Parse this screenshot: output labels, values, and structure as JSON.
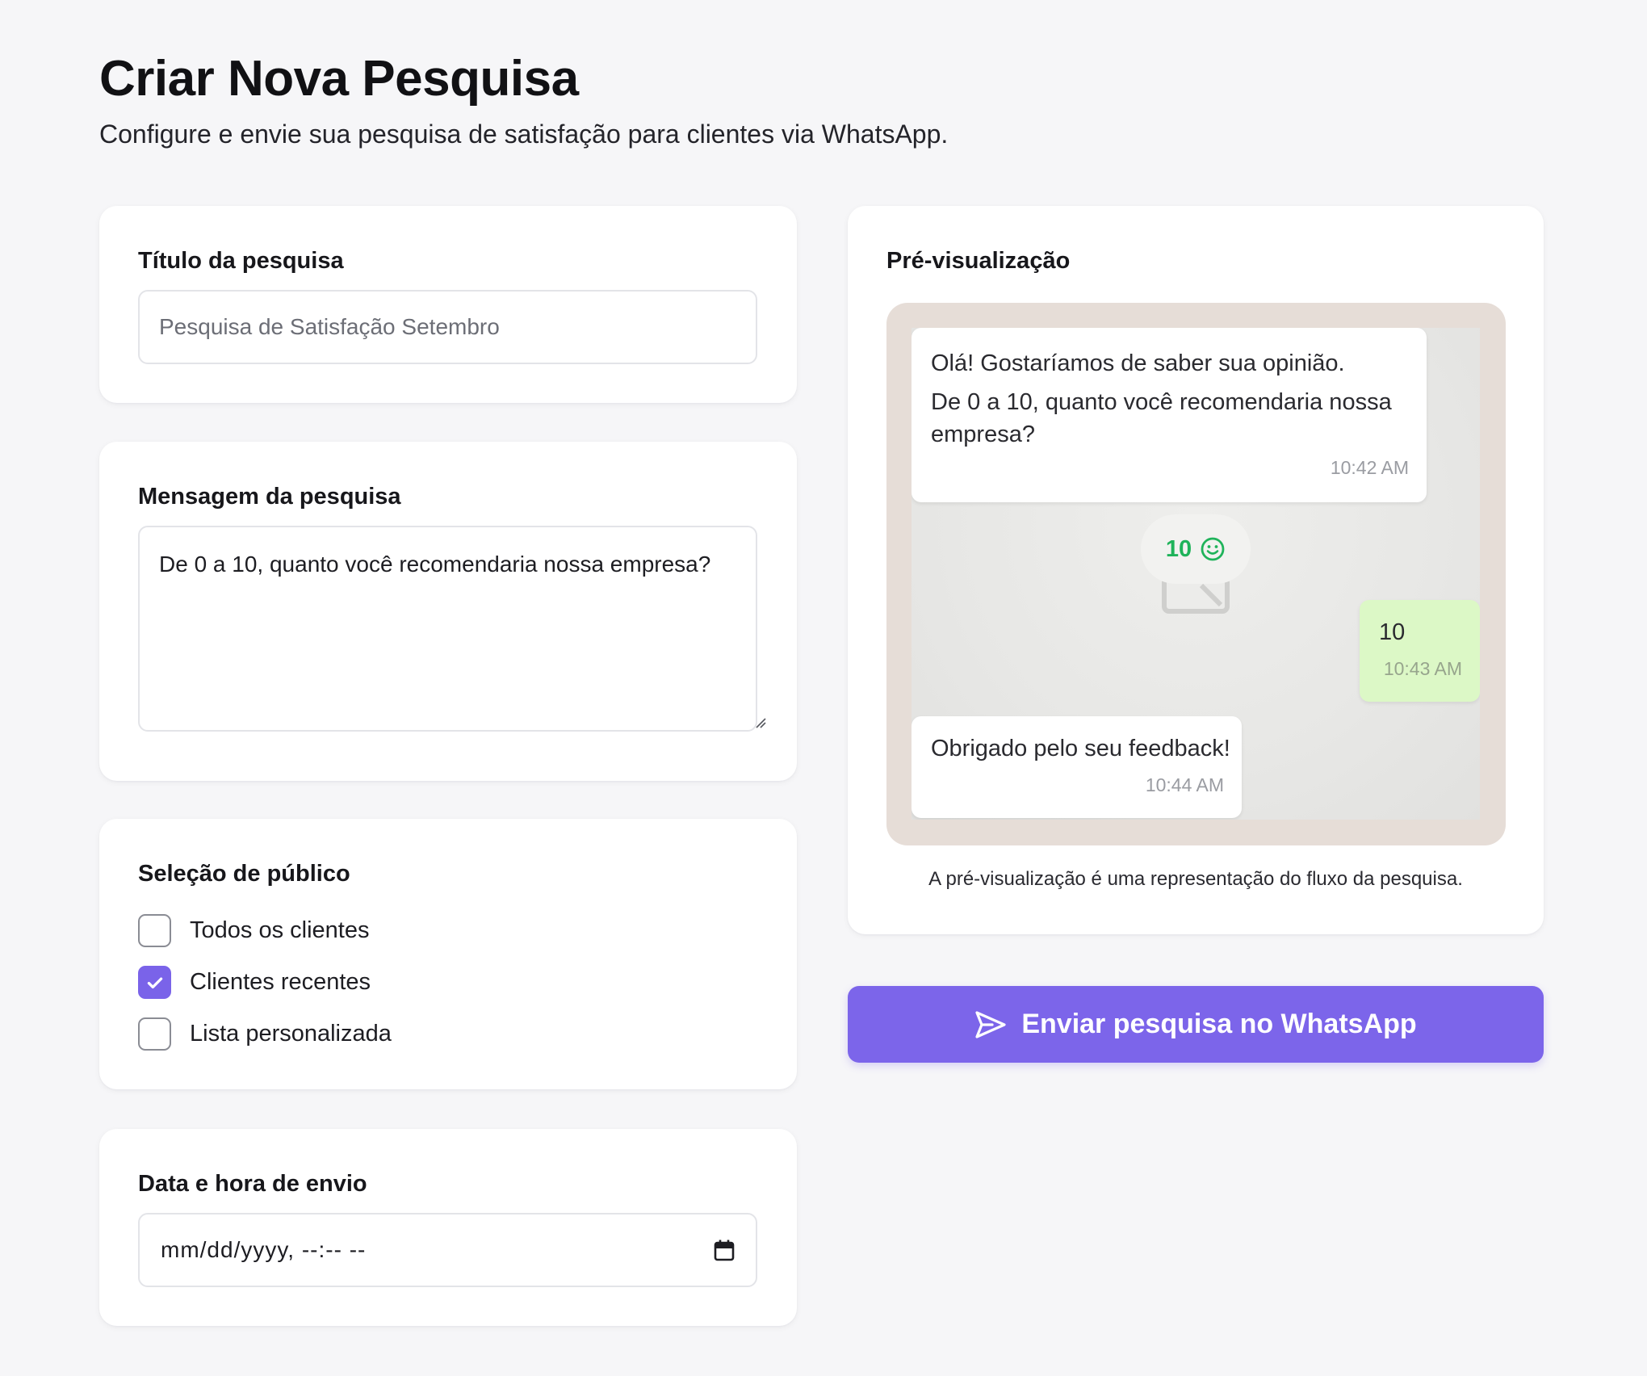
{
  "header": {
    "title": "Criar Nova Pesquisa",
    "subtitle": "Configure e envie sua pesquisa de satisfação para clientes via WhatsApp."
  },
  "survey_title": {
    "label": "Título da pesquisa",
    "placeholder": "Pesquisa de Satisfação Setembro",
    "value": ""
  },
  "survey_message": {
    "label": "Mensagem da pesquisa",
    "value": "De 0 a 10, quanto você recomendaria nossa empresa?"
  },
  "audience": {
    "label": "Seleção de público",
    "options": [
      {
        "label": "Todos os clientes",
        "checked": false
      },
      {
        "label": "Clientes recentes",
        "checked": true
      },
      {
        "label": "Lista personalizada",
        "checked": false
      }
    ]
  },
  "schedule": {
    "label": "Data e hora de envio",
    "value": "mm/dd/yyyy, --:-- --",
    "icon": "calendar-icon"
  },
  "preview": {
    "label": "Pré-visualização",
    "messages": [
      {
        "line1": "Olá! Gostaríamos de saber sua opinião.",
        "line2": "De 0 a 10, quanto você recomendaria nossa empresa?",
        "time": "10:42 AM"
      },
      {
        "text": "10",
        "time": "10:43 AM"
      },
      {
        "text": "Obrigado pelo seu feedback!",
        "time": "10:44 AM"
      }
    ],
    "reaction": {
      "value": "10",
      "icon": "smile-icon",
      "color": "#1fb35a"
    },
    "note": "A pré-visualização é uma representação do fluxo da pesquisa."
  },
  "send_button": {
    "label": "Enviar pesquisa no WhatsApp",
    "icon": "send-icon",
    "color": "#7c65ea"
  },
  "colors": {
    "accent": "#7a63e9",
    "outgoing_bubble": "#dcf8c6",
    "chat_frame": "#e6ddd7"
  }
}
